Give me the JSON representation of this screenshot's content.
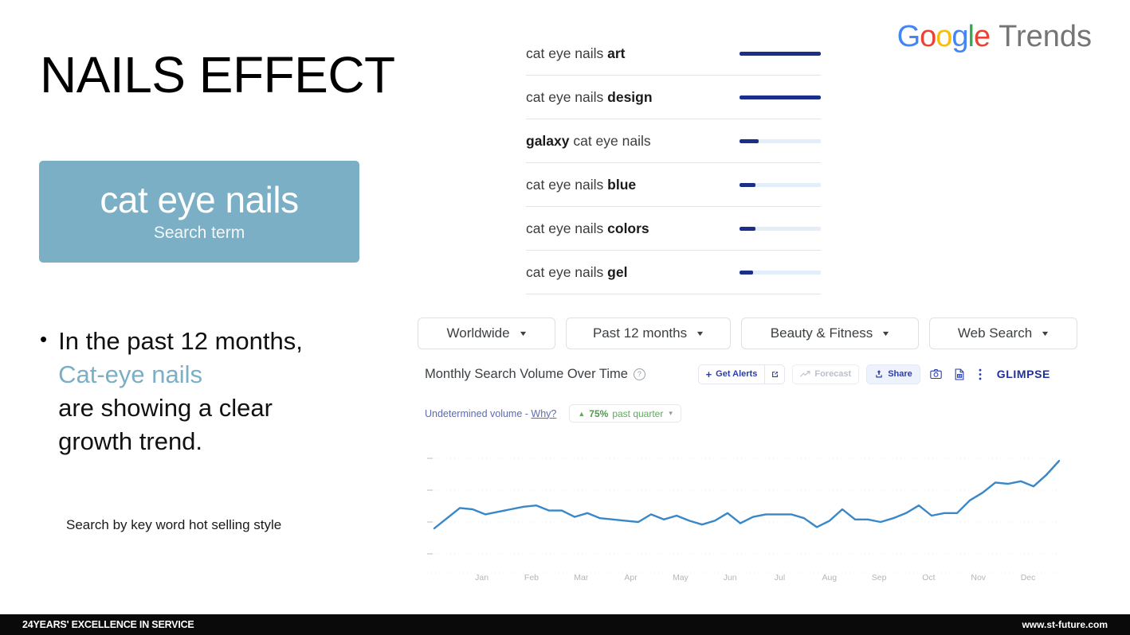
{
  "slide": {
    "title": "NAILS EFFECT",
    "term_card": {
      "term": "cat eye nails",
      "subtitle": "Search term",
      "color": "#7bafc5"
    },
    "bullet": {
      "marker": "•",
      "line1": "In the past 12 months,",
      "highlight": "Cat-eye nails",
      "line2": "are showing a clear",
      "line3": "growth trend.",
      "highlight_color": "#7bafc5"
    },
    "footnote": "Search by key word hot selling style"
  },
  "logo": {
    "g1": "G",
    "o1": "o",
    "o2": "o",
    "g2": "g",
    "l1": "l",
    "e1": "e",
    "trends": "Trends",
    "colors": {
      "blue": "#4285F4",
      "red": "#EA4335",
      "yellow": "#FBBC05",
      "green": "#34A853",
      "grey": "#757575"
    }
  },
  "related_queries": [
    {
      "prefix": "cat eye nails ",
      "bold": "art",
      "suffix": "",
      "value": 100
    },
    {
      "prefix": "cat eye nails ",
      "bold": "design",
      "suffix": "",
      "value": 100
    },
    {
      "prefix": "",
      "bold": "galaxy",
      "suffix": " cat eye nails",
      "value": 24
    },
    {
      "prefix": "cat eye nails ",
      "bold": "blue",
      "suffix": "",
      "value": 20
    },
    {
      "prefix": "cat eye nails ",
      "bold": "colors",
      "suffix": "",
      "value": 20
    },
    {
      "prefix": "cat eye nails ",
      "bold": "gel",
      "suffix": "",
      "value": 17
    }
  ],
  "filters": [
    {
      "label": "Worldwide",
      "icon": "chevron-down-icon"
    },
    {
      "label": "Past 12 months",
      "icon": "chevron-down-icon"
    },
    {
      "label": "Beauty & Fitness",
      "icon": "chevron-down-icon"
    },
    {
      "label": "Web Search",
      "icon": "chevron-down-icon"
    }
  ],
  "glimpse": {
    "panel_title": "Monthly Search Volume Over Time",
    "help_icon": "help-circle-icon",
    "get_alerts": "Get Alerts",
    "open_external_icon": "external-link-icon",
    "forecast": "Forecast",
    "forecast_icon": "trend-line-icon",
    "share": "Share",
    "share_icon": "share-upload-icon",
    "camera_icon": "camera-icon",
    "report_icon": "document-report-icon",
    "more_icon": "more-vertical-icon",
    "brand": "GLIMPSE",
    "brand_color": "#21309b",
    "volume_note_text": "Undetermined volume - ",
    "volume_note_link": "Why?",
    "trend_arrow": "▲",
    "trend_pct": "75%",
    "trend_period": "past quarter",
    "trend_chevron": "chevron-down-icon",
    "trend_color": "#5ea85e"
  },
  "chart_data": {
    "type": "line",
    "title": "Monthly Search Volume Over Time",
    "xlabel": "",
    "ylabel": "",
    "grid": true,
    "legend": null,
    "line_color": "#3a87c8",
    "y_axis_labeled": false,
    "ylim": [
      0,
      100
    ],
    "categories": [
      "Jan",
      "Feb",
      "Mar",
      "Apr",
      "May",
      "Jun",
      "Jul",
      "Aug",
      "Sep",
      "Oct",
      "Nov",
      "Dec"
    ],
    "x": [
      "Dec-w1",
      "Dec-w2",
      "Dec-w3",
      "Dec-w4",
      "Jan-w1",
      "Jan-w2",
      "Jan-w3",
      "Jan-w4",
      "Feb-w1",
      "Feb-w2",
      "Feb-w3",
      "Feb-w4",
      "Mar-w1",
      "Mar-w2",
      "Mar-w3",
      "Mar-w4",
      "Apr-w1",
      "Apr-w2",
      "Apr-w3",
      "Apr-w4",
      "May-w1",
      "May-w2",
      "May-w3",
      "May-w4",
      "Jun-w1",
      "Jun-w2",
      "Jun-w3",
      "Jun-w4",
      "Jul-w1",
      "Jul-w2",
      "Jul-w3",
      "Jul-w4",
      "Aug-w1",
      "Aug-w2",
      "Aug-w3",
      "Aug-w4",
      "Sep-w1",
      "Sep-w2",
      "Sep-w3",
      "Sep-w4",
      "Oct-w1",
      "Oct-w2",
      "Oct-w3",
      "Oct-w4",
      "Nov-w1",
      "Nov-w2",
      "Nov-w3",
      "Nov-w4",
      "Dec-w5",
      "Dec-w6"
    ],
    "values": [
      30,
      38,
      46,
      45,
      41,
      43,
      45,
      47,
      48,
      44,
      44,
      39,
      42,
      38,
      37,
      36,
      35,
      41,
      37,
      40,
      36,
      33,
      36,
      42,
      34,
      39,
      41,
      41,
      41,
      38,
      31,
      36,
      45,
      37,
      37,
      35,
      38,
      42,
      48,
      40,
      42,
      42,
      52,
      58,
      66,
      65,
      67,
      63,
      72,
      83
    ],
    "series": [
      {
        "name": "cat eye nails",
        "color": "#3a87c8"
      }
    ]
  },
  "footer": {
    "left": "24YEARS' EXCELLENCE IN SERVICE",
    "right": "www.st-future.com"
  }
}
